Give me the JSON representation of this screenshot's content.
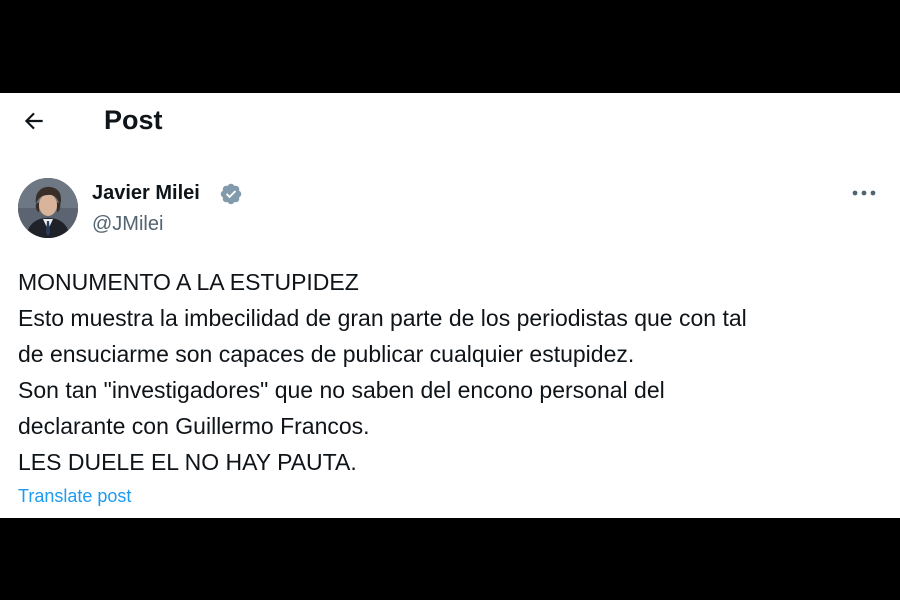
{
  "header": {
    "back_icon": "arrow-left-icon",
    "title": "Post"
  },
  "post": {
    "author_name": "Javier Milei",
    "author_handle": "@JMilei",
    "verified_icon": "verified-badge-icon",
    "more_icon": "more-horizontal-icon",
    "lines": [
      "MONUMENTO A LA ESTUPIDEZ",
      "Esto muestra la imbecilidad de gran parte de los periodistas que con tal",
      "de ensuciarme son capaces de publicar cualquier estupidez.",
      "Son tan \"investigadores\" que no saben del encono personal del",
      "declarante con Guillermo Francos.",
      "LES DUELE EL NO HAY PAUTA."
    ],
    "translate_label": "Translate post"
  },
  "colors": {
    "text": "#0f1419",
    "secondary": "#536471",
    "link": "#1d9bf0",
    "verified": "#829aab"
  }
}
